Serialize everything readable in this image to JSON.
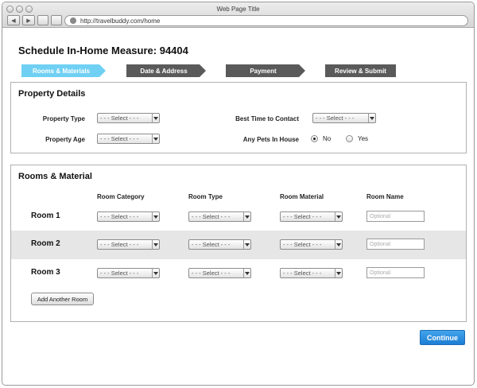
{
  "window": {
    "title": "Web Page Title",
    "url": "http://travelbuddy.com/home"
  },
  "page": {
    "title": "Schedule In-Home Measure: 94404"
  },
  "steps": [
    {
      "label": "Rooms & Materials",
      "state": "active"
    },
    {
      "label": "Date & Address",
      "state": "inactive"
    },
    {
      "label": "Payment",
      "state": "inactive"
    },
    {
      "label": "Review & Submit",
      "state": "inactive"
    }
  ],
  "property": {
    "title": "Property Details",
    "property_type_label": "Property Type",
    "property_type_value": "- - - Select - - -",
    "property_age_label": "Property Age",
    "property_age_value": "- - - Select - - -",
    "best_time_label": "Best Time to  Contact",
    "best_time_value": "- - - Select - - -",
    "pets_label": "Any Pets In House",
    "pets_options": [
      {
        "label": "No",
        "selected": true
      },
      {
        "label": "Yes",
        "selected": false
      }
    ]
  },
  "rooms": {
    "title": "Rooms & Material",
    "columns": [
      "Room Category",
      "Room Type",
      "Room Material",
      "Room Name"
    ],
    "rows": [
      {
        "label": "Room 1",
        "category": "- - - Select - - -",
        "type": "- - - Select - - -",
        "material": "- - - Select - - -",
        "name_placeholder": "Optional"
      },
      {
        "label": "Room 2",
        "category": "- - - Select - - -",
        "type": "- - - Select - - -",
        "material": "- - - Select - - -",
        "name_placeholder": "Optional"
      },
      {
        "label": "Room 3",
        "category": "- - - Select - - -",
        "type": "- - - Select - - -",
        "material": "- - - Select - - -",
        "name_placeholder": "Optional"
      }
    ],
    "add_button": "Add Another Room"
  },
  "continue_button": "Continue",
  "colors": {
    "active_step": "#6fd0f4",
    "inactive_step": "#5a5a5a",
    "primary": "#1c7fd3",
    "shaded_row": "#e6e6e6"
  }
}
